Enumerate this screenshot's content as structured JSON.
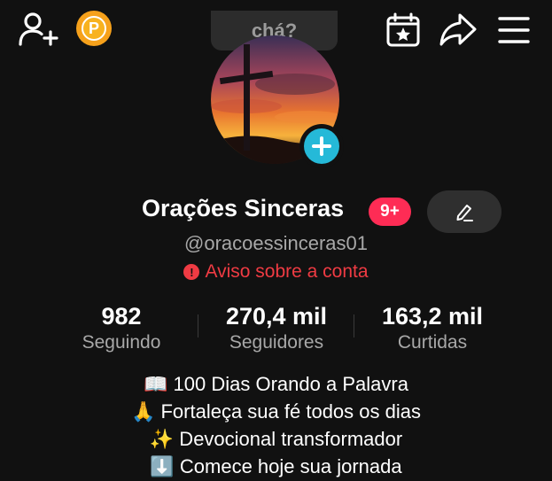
{
  "topbar": {
    "search_text": "chá?",
    "points_letter": "P"
  },
  "profile": {
    "name": "Orações Sinceras",
    "notif_count": "9+",
    "handle": "@oracoessinceras01",
    "warning": "Aviso sobre a conta"
  },
  "stats": [
    {
      "value": "982",
      "label": "Seguindo"
    },
    {
      "value": "270,4 mil",
      "label": "Seguidores"
    },
    {
      "value": "163,2 mil",
      "label": "Curtidas"
    }
  ],
  "bio": [
    "📖 100 Dias Orando a Palavra",
    "🙏 Fortaleça sua fé todos os dias",
    "✨ Devocional transformador",
    "⬇️ Comece hoje sua jornada"
  ],
  "colors": {
    "background": "#111111",
    "accent_red": "#fe2c55",
    "warning_red": "#ef3b43",
    "plus_blue": "#25b9d8",
    "points_orange": "#f6a11b"
  },
  "icons": [
    "add-user-icon",
    "points-icon",
    "calendar-star-icon",
    "share-icon",
    "menu-icon",
    "plus-icon",
    "edit-icon",
    "warning-icon"
  ]
}
